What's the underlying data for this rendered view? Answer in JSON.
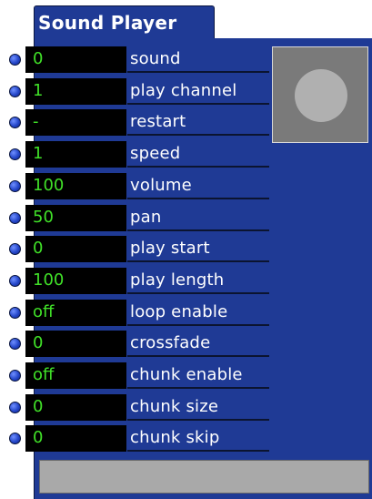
{
  "title": "Sound Player",
  "status_text": "",
  "parameters": [
    {
      "label": "sound",
      "value": "0"
    },
    {
      "label": "play channel",
      "value": "1"
    },
    {
      "label": "restart",
      "value": "-"
    },
    {
      "label": "speed",
      "value": "1"
    },
    {
      "label": "volume",
      "value": "100"
    },
    {
      "label": "pan",
      "value": "50"
    },
    {
      "label": "play start",
      "value": "0"
    },
    {
      "label": "play length",
      "value": "100"
    },
    {
      "label": "loop enable",
      "value": "off"
    },
    {
      "label": "crossfade",
      "value": "0"
    },
    {
      "label": "chunk enable",
      "value": "off"
    },
    {
      "label": "chunk size",
      "value": "0"
    },
    {
      "label": "chunk skip",
      "value": "0"
    }
  ],
  "colors": {
    "panel": "#1f3a95",
    "value_text": "#40e028",
    "value_bg": "#000000",
    "label_text": "#ffffff",
    "inlet": "#2446c8"
  }
}
